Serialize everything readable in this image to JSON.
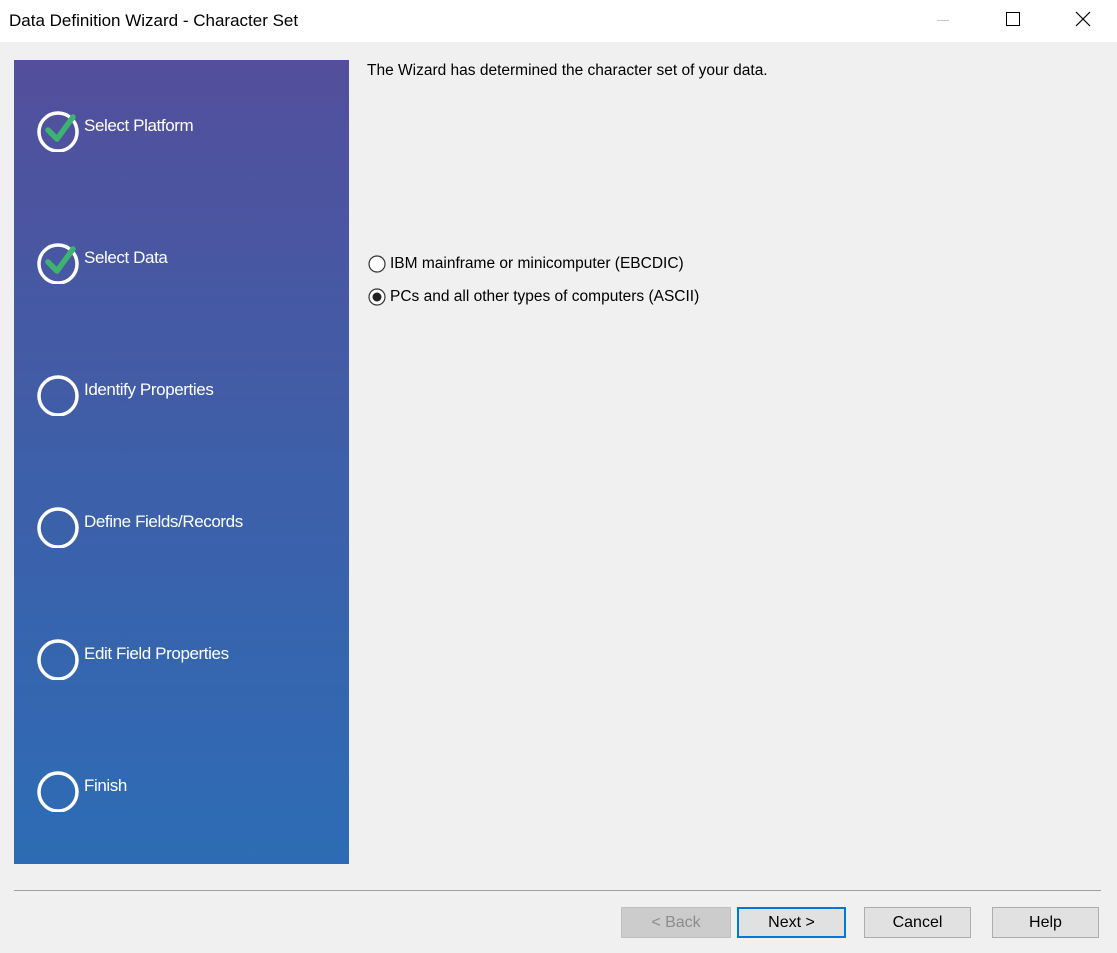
{
  "window": {
    "title": "Data Definition Wizard - Character Set",
    "controls": [
      "minimize-icon",
      "maximize-icon",
      "close-icon"
    ]
  },
  "sidebar": {
    "steps": [
      {
        "label": "Select Platform",
        "status": "completed"
      },
      {
        "label": "Select Data",
        "status": "completed"
      },
      {
        "label": "Identify Properties",
        "status": "pending"
      },
      {
        "label": "Define Fields/Records",
        "status": "pending"
      },
      {
        "label": "Edit Field Properties",
        "status": "pending"
      },
      {
        "label": "Finish",
        "status": "pending"
      }
    ],
    "colors": {
      "gradient_top": "#534f9c",
      "gradient_bottom": "#2d6cb5",
      "check": "#3cb371"
    }
  },
  "main": {
    "message": "The Wizard has determined the character set of your data.",
    "options": [
      {
        "label": "IBM mainframe or minicomputer (EBCDIC)",
        "selected": false
      },
      {
        "label": "PCs and all other types of computers (ASCII)",
        "selected": true
      }
    ]
  },
  "footer": {
    "back_label": "< Back",
    "next_label": "Next >",
    "cancel_label": "Cancel",
    "help_label": "Help",
    "back_enabled": false,
    "default_button": "next",
    "accent": "#0078d7"
  }
}
